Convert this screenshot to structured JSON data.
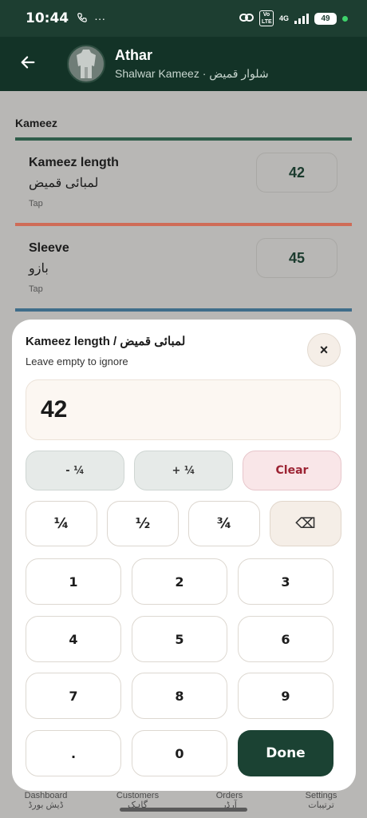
{
  "status": {
    "time": "10:44",
    "network": "4G",
    "volte": "Vo LTE",
    "battery": "49"
  },
  "header": {
    "customer_name": "Athar",
    "subtitle": "Shalwar Kameez · شلوار قمیض"
  },
  "section": {
    "title": "Kameez"
  },
  "measurements": [
    {
      "label": "Kameez length",
      "urdu": "لمبائی قمیض",
      "hint": "Tap",
      "value": "42",
      "color": "#2f5d4a"
    },
    {
      "label": "Sleeve",
      "urdu": "بازو",
      "hint": "Tap",
      "value": "45",
      "color": "#cf6c57"
    }
  ],
  "divider_colors": [
    "#2f5d4a",
    "#cf6c57",
    "#3f6d8a"
  ],
  "nav": {
    "items": [
      {
        "en": "Dashboard",
        "ur": "ڈیش بورڈ"
      },
      {
        "en": "Customers",
        "ur": "گاہک"
      },
      {
        "en": "Orders",
        "ur": "آرڈر"
      },
      {
        "en": "Settings",
        "ur": "ترتیبات"
      }
    ]
  },
  "sheet": {
    "title": "Kameez length / لمبائی قمیض",
    "hint": "Leave empty to ignore",
    "value": "42",
    "close_icon": "×",
    "quick": {
      "minus": "- ¼",
      "plus": "+ ¼",
      "clear": "Clear"
    },
    "fractions": [
      "¼",
      "½",
      "¾"
    ],
    "backspace_icon": "⌫",
    "keys": [
      "1",
      "2",
      "3",
      "4",
      "5",
      "6",
      "7",
      "8",
      "9",
      ".",
      "0"
    ],
    "done": "Done"
  }
}
